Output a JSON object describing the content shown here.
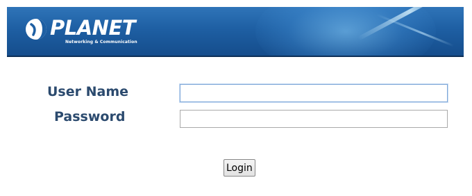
{
  "header": {
    "brand_name": "PLANET",
    "brand_tagline": "Networking & Communication",
    "icon": "planet-logo-icon",
    "colors": {
      "banner": "#1e5fa3",
      "banner_border": "#0d2f57"
    }
  },
  "login_form": {
    "username_label": "User Name",
    "password_label": "Password",
    "username_value": "",
    "password_value": "",
    "login_button_label": "Login",
    "label_color": "#2b4a6e"
  }
}
